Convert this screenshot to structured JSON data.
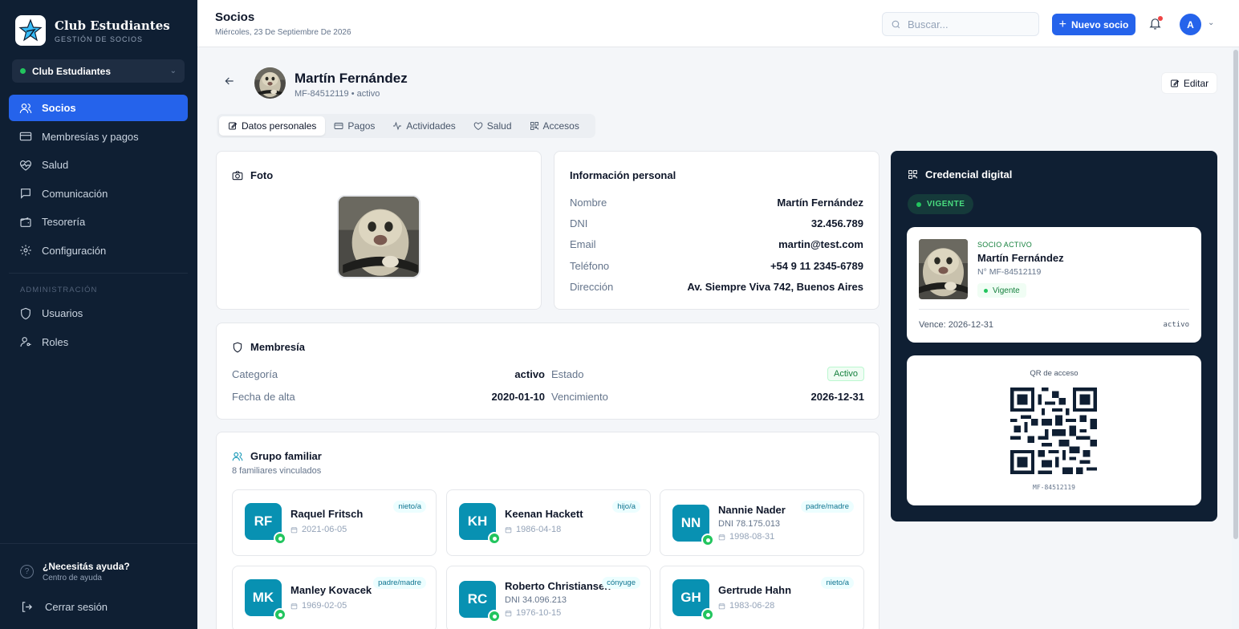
{
  "brand": {
    "name": "Club Estudiantes",
    "subtitle": "GESTIÓN DE SOCIOS"
  },
  "club_selector": {
    "value": "Club Estudiantes"
  },
  "sidebar": {
    "items": [
      {
        "label": "Socios",
        "icon": "users-icon",
        "active": true
      },
      {
        "label": "Membresías y pagos",
        "icon": "credit-card-icon"
      },
      {
        "label": "Salud",
        "icon": "heart-pulse-icon"
      },
      {
        "label": "Comunicación",
        "icon": "message-icon"
      },
      {
        "label": "Tesorería",
        "icon": "wallet-icon"
      },
      {
        "label": "Configuración",
        "icon": "gear-icon"
      }
    ],
    "admin_section": "ADMINISTRACIÓN",
    "admin_items": [
      {
        "label": "Usuarios",
        "icon": "shield-icon"
      },
      {
        "label": "Roles",
        "icon": "user-key-icon"
      }
    ],
    "help": {
      "title": "¿Necesitás ayuda?",
      "subtitle": "Centro de ayuda"
    },
    "logout": "Cerrar sesión"
  },
  "header": {
    "title": "Socios",
    "date": "Miércoles, 23 De Septiembre De 2026",
    "search_placeholder": "Buscar...",
    "new_button": "Nuevo socio",
    "avatar_initial": "A"
  },
  "profile": {
    "name": "Martín Fernández",
    "subtitle": "MF-84512119 • activo",
    "edit_label": "Editar"
  },
  "tabs": [
    {
      "label": "Datos personales",
      "icon": "edit-icon",
      "active": true
    },
    {
      "label": "Pagos",
      "icon": "credit-card-icon"
    },
    {
      "label": "Actividades",
      "icon": "activity-icon"
    },
    {
      "label": "Salud",
      "icon": "heart-pulse-icon"
    },
    {
      "label": "Accesos",
      "icon": "qr-icon"
    }
  ],
  "photo_card": {
    "title": "Foto"
  },
  "personal_info": {
    "title": "Información personal",
    "rows": [
      {
        "label": "Nombre",
        "value": "Martín Fernández"
      },
      {
        "label": "DNI",
        "value": "32.456.789"
      },
      {
        "label": "Email",
        "value": "martin@test.com"
      },
      {
        "label": "Teléfono",
        "value": "+54 9 11 2345-6789"
      },
      {
        "label": "Dirección",
        "value": "Av. Siempre Viva 742, Buenos Aires"
      }
    ]
  },
  "membership": {
    "title": "Membresía",
    "category_label": "Categoría",
    "category_value": "activo",
    "state_label": "Estado",
    "state_value": "Activo",
    "since_label": "Fecha de alta",
    "since_value": "2020-01-10",
    "expiry_label": "Vencimiento",
    "expiry_value": "2026-12-31"
  },
  "family": {
    "title": "Grupo familiar",
    "subtitle": "8 familiares vinculados",
    "members": [
      {
        "initials": "RF",
        "name": "Raquel Fritsch",
        "dni": "",
        "date": "2021-06-05",
        "relation": "nieto/a"
      },
      {
        "initials": "KH",
        "name": "Keenan Hackett",
        "dni": "",
        "date": "1986-04-18",
        "relation": "hijo/a"
      },
      {
        "initials": "NN",
        "name": "Nannie Nader",
        "dni": "DNI 78.175.013",
        "date": "1998-08-31",
        "relation": "padre/madre"
      },
      {
        "initials": "MK",
        "name": "Manley Kovacek",
        "dni": "",
        "date": "1969-02-05",
        "relation": "padre/madre"
      },
      {
        "initials": "RC",
        "name": "Roberto Christiansen",
        "dni": "DNI 34.096.213",
        "date": "1976-10-15",
        "relation": "cónyuge"
      },
      {
        "initials": "GH",
        "name": "Gertrude Hahn",
        "dni": "",
        "date": "1983-06-28",
        "relation": "nieto/a"
      }
    ]
  },
  "credential": {
    "title": "Credencial digital",
    "status_badge": "VIGENTE",
    "role": "SOCIO ACTIVO",
    "name": "Martín Fernández",
    "number": "N° MF-84512119",
    "status": "Vigente",
    "expiry": "Vence: 2026-12-31",
    "state": "activo",
    "qr_label": "QR de acceso",
    "qr_code": "MF-84512119"
  },
  "colors": {
    "primary": "#2563eb",
    "sidebar": "#0f1f33",
    "success": "#22c55e",
    "family_avatar": "#0891b2"
  }
}
